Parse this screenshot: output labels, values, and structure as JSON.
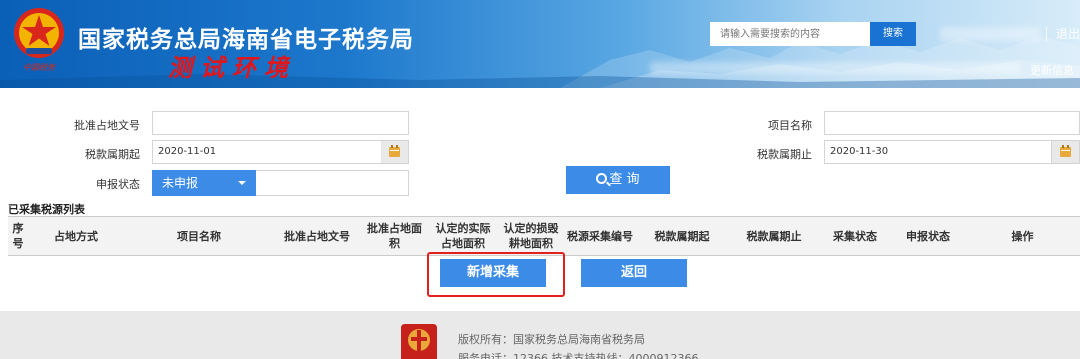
{
  "header": {
    "title": "国家税务总局海南省电子税务局",
    "env_badge": "测试环境",
    "emblem_caption": "中国税务",
    "search_placeholder": "请输入需要搜索的内容",
    "search_button": "搜索",
    "logout": "退出",
    "update_info": "更新信息"
  },
  "form": {
    "approval_doc_label": "批准占地文号",
    "approval_doc_value": "",
    "project_name_label": "项目名称",
    "project_name_value": "",
    "tax_period_start_label": "税款属期起",
    "tax_period_start_value": "2020-11-01",
    "tax_period_end_label": "税款属期止",
    "tax_period_end_value": "2020-11-30",
    "declare_status_label": "申报状态",
    "declare_status_value": "未申报",
    "query_button": "查 询"
  },
  "table": {
    "section_title": "已采集税源列表",
    "columns": [
      "序号",
      "占地方式",
      "项目名称",
      "批准占地文号",
      "批准占地面积",
      "认定的实际占地面积",
      "认定的损毁耕地面积",
      "税源采集编号",
      "税款属期起",
      "税款属期止",
      "采集状态",
      "申报状态",
      "操作"
    ],
    "rows": []
  },
  "actions": {
    "add_button": "新增采集",
    "back_button": "返回"
  },
  "footer": {
    "copyright": "版权所有：国家税务总局海南省税务局",
    "service_line": "服务电话：12366 技术支持热线：4000912366"
  },
  "colors": {
    "primary_button": "#3c8be6",
    "header_blue": "#0a5fb6",
    "highlight_red": "#e1211b",
    "test_env_red": "#e0161b"
  }
}
